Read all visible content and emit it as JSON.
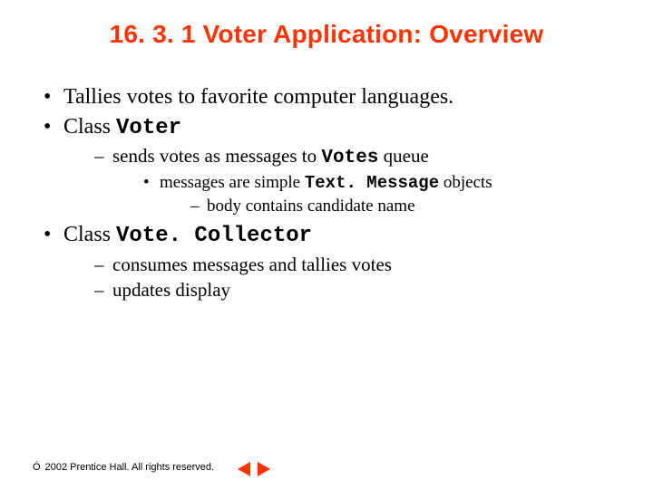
{
  "colors": {
    "accent": "#ff3300"
  },
  "title": "16. 3. 1   Voter Application: Overview",
  "bullets": {
    "b1": "Tallies votes to favorite computer languages.",
    "b2_pre": "Class ",
    "b2_code": "Voter",
    "b2_1_pre": "sends votes as messages to ",
    "b2_1_code": "Votes",
    "b2_1_post": " queue",
    "b2_1_1_pre": "messages are simple ",
    "b2_1_1_code": "Text. Message",
    "b2_1_1_post": " objects",
    "b2_1_1_1": "body contains candidate name",
    "b3_pre": "Class ",
    "b3_code": "Vote. Collector",
    "b3_1": "consumes messages and tallies votes",
    "b3_2": "updates display"
  },
  "footer": {
    "copyright_symbol": "Ó",
    "text": " 2002 Prentice Hall. All rights reserved."
  },
  "nav": {
    "prev": "previous slide",
    "next": "next slide"
  }
}
